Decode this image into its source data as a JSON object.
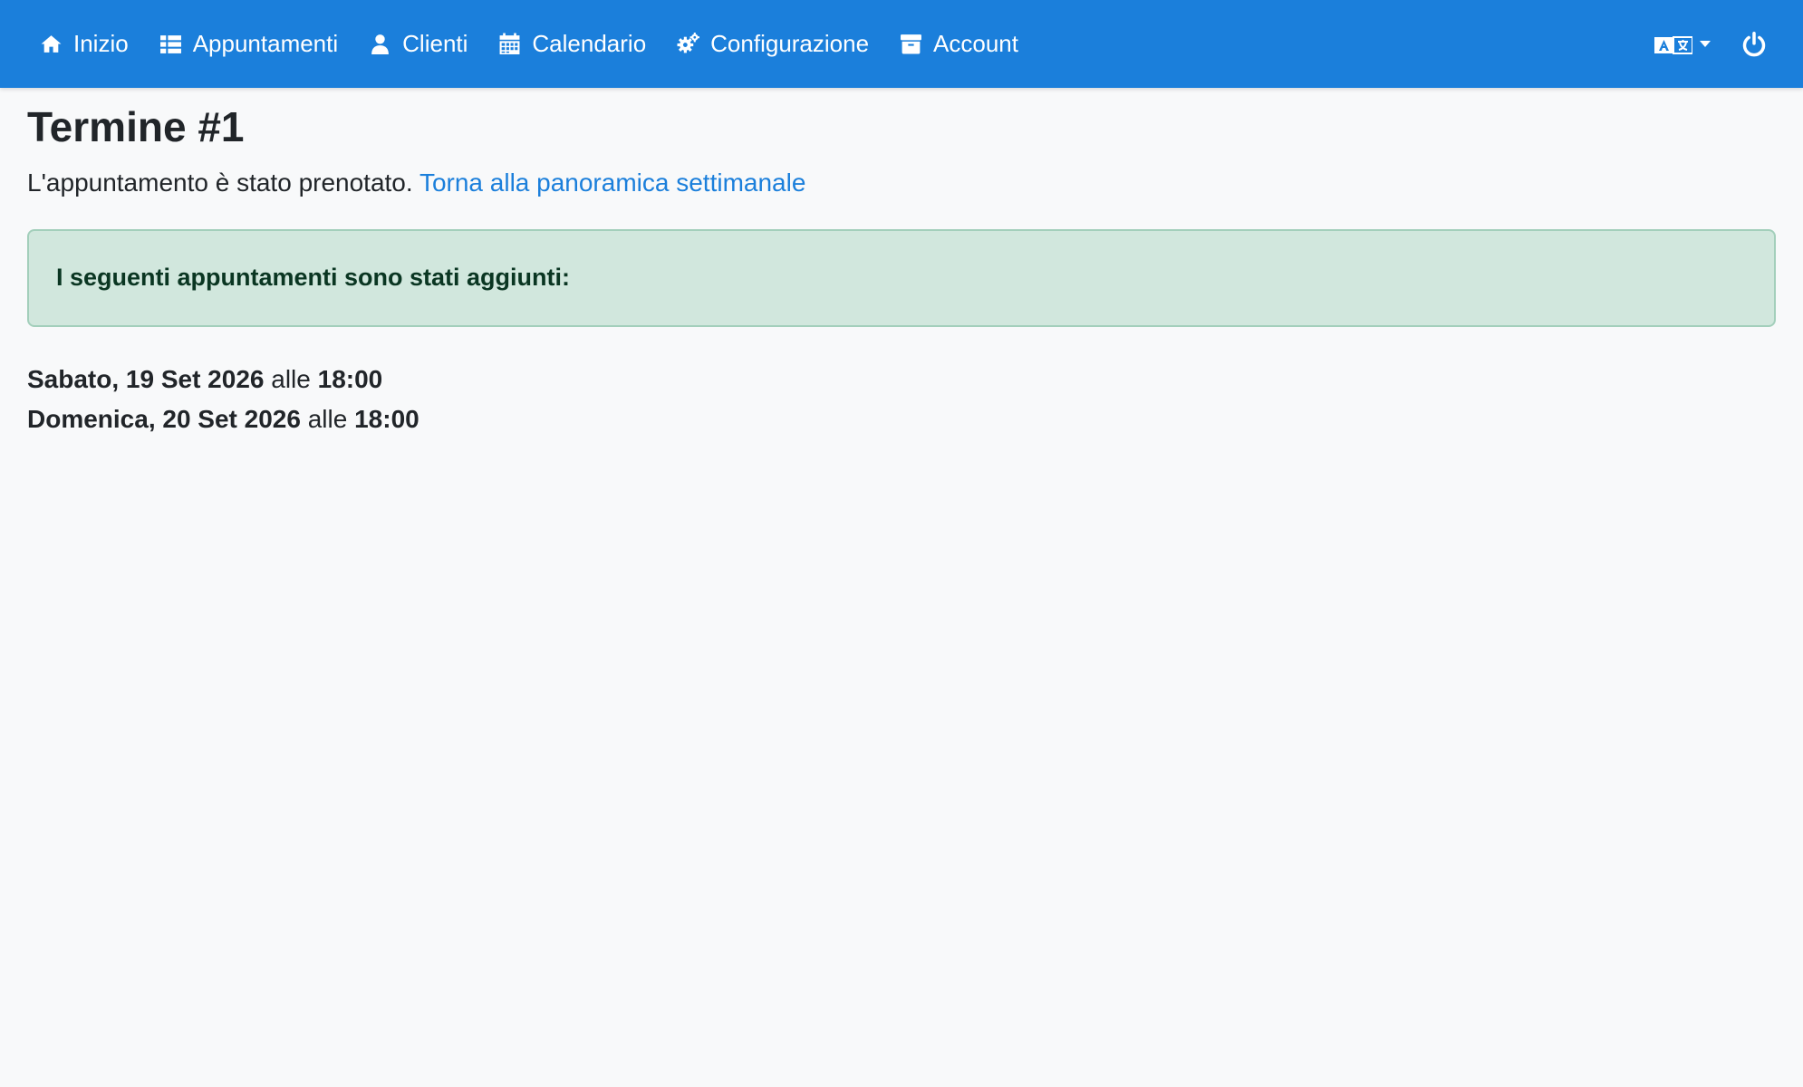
{
  "nav": {
    "items": [
      {
        "label": "Inizio",
        "icon": "home-icon"
      },
      {
        "label": "Appuntamenti",
        "icon": "list-icon"
      },
      {
        "label": "Clienti",
        "icon": "user-icon"
      },
      {
        "label": "Calendario",
        "icon": "calendar-icon"
      },
      {
        "label": "Configurazione",
        "icon": "gears-icon"
      },
      {
        "label": "Account",
        "icon": "archive-icon"
      }
    ],
    "language_icon": "translate-icon",
    "logout_icon": "power-icon"
  },
  "page": {
    "title": "Termine #1",
    "status_text": "L'appuntamento è stato prenotato.",
    "back_link": "Torna alla panoramica settimanale"
  },
  "alert": {
    "text": "I seguenti appuntamenti sono stati aggiunti:"
  },
  "appointments": [
    {
      "date": "Sabato, 19 Set 2026",
      "connector": "alle",
      "time": "18:00"
    },
    {
      "date": "Domenica, 20 Set 2026",
      "connector": "alle",
      "time": "18:00"
    }
  ],
  "colors": {
    "navbar": "#1b7fdb",
    "link": "#1b7fdb",
    "alert_bg": "#d1e7dd",
    "alert_text": "#0a3622"
  }
}
